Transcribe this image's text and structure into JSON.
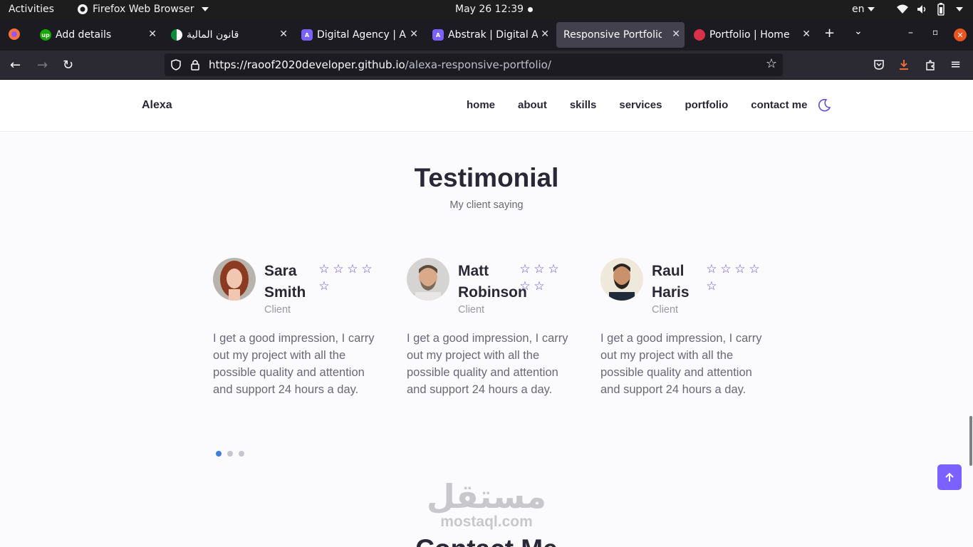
{
  "gnome": {
    "activities": "Activities",
    "app_name": "Firefox Web Browser",
    "clock": "May 26  12:39",
    "lang": "en"
  },
  "tabs": [
    {
      "title": "Add details",
      "favicon": "upwork-icon",
      "color": "#14a800"
    },
    {
      "title": "قانون المالية",
      "favicon": "algeria-flag-icon",
      "color": "#0b8b3b"
    },
    {
      "title": "Digital Agency | Ab",
      "favicon": "abstrak-icon",
      "color": "#7b61ff"
    },
    {
      "title": "Abstrak | Digital Ag",
      "favicon": "abstrak-icon",
      "color": "#7b61ff"
    },
    {
      "title": "Responsive Portfolio W",
      "favicon": "",
      "color": ""
    },
    {
      "title": "Portfolio | Home",
      "favicon": "portfolio-icon",
      "color": "#d9314a"
    }
  ],
  "url": {
    "host": "https://raoof2020developer.github.io",
    "path": "/alexa-responsive-portfolio/"
  },
  "site": {
    "logo": "Alexa",
    "nav": [
      "home",
      "about",
      "skills",
      "services",
      "portfolio",
      "contact me"
    ]
  },
  "testimonial": {
    "title": "Testimonial",
    "subtitle": "My client saying",
    "cards": [
      {
        "name": "Sara Smith",
        "role": "Client",
        "stars": 5,
        "text": "I get a good impression, I carry out my project with all the possible quality and attention and support 24 hours a day."
      },
      {
        "name": "Matt Robinson",
        "role": "Client",
        "stars": 5,
        "text": "I get a good impression, I carry out my project with all the possible quality and attention and support 24 hours a day."
      },
      {
        "name": "Raul Haris",
        "role": "Client",
        "stars": 5,
        "text": "I get a good impression, I carry out my project with all the possible quality and attention and support 24 hours a day."
      }
    ],
    "pagination": {
      "pages": 3,
      "active": 0
    }
  },
  "watermark": {
    "arabic": "مستقل",
    "latin": "mostaql.com"
  },
  "contact": {
    "title": "Contact Me"
  },
  "colors": {
    "accent": "#7b61ff",
    "star": "#5f4bd8",
    "dot_active": "#3d7fd9"
  }
}
